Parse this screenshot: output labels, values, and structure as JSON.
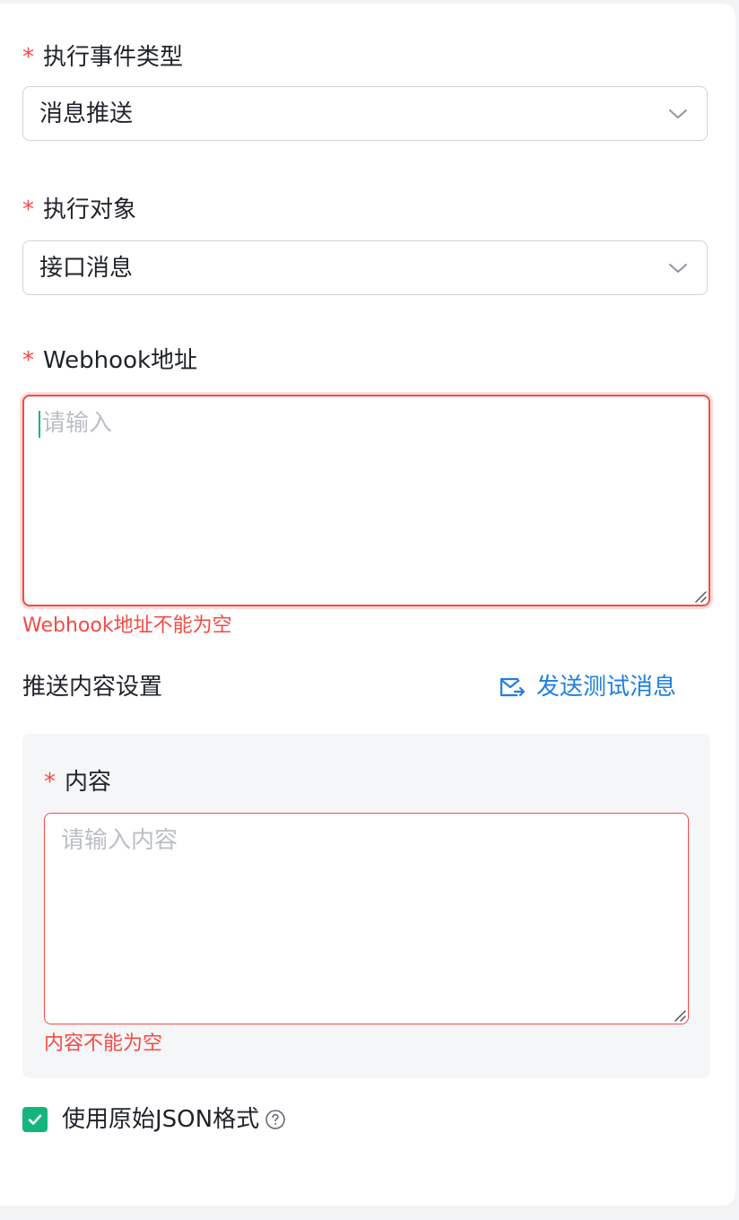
{
  "form": {
    "event_type": {
      "required_mark": "*",
      "label": "执行事件类型",
      "value": "消息推送"
    },
    "target": {
      "required_mark": "*",
      "label": "执行对象",
      "value": "接口消息"
    },
    "webhook": {
      "required_mark": "*",
      "label": "Webhook地址",
      "placeholder": "请输入",
      "error": "Webhook地址不能为空"
    },
    "push_settings": {
      "title": "推送内容设置",
      "send_test_label": "发送测试消息"
    },
    "content": {
      "required_mark": "*",
      "label": "内容",
      "placeholder": "请输入内容",
      "error": "内容不能为空"
    },
    "raw_json": {
      "label": "使用原始JSON格式",
      "checked": true
    }
  },
  "colors": {
    "required": "#f54a45",
    "error": "#f54a45",
    "link": "#1f7fe0",
    "checkbox": "#14b57c"
  }
}
